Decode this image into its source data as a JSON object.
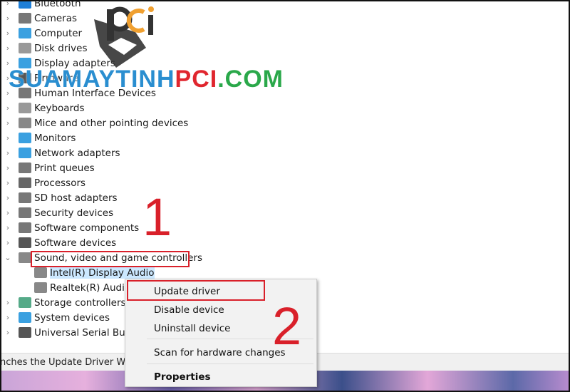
{
  "tree": {
    "items": [
      {
        "label": "Bluetooth",
        "icon": "bluetooth-icon",
        "color": "#1e7fd8"
      },
      {
        "label": "Cameras",
        "icon": "camera-icon",
        "color": "#777"
      },
      {
        "label": "Computer",
        "icon": "computer-icon",
        "color": "#3aa0e0"
      },
      {
        "label": "Disk drives",
        "icon": "disk-drive-icon",
        "color": "#999"
      },
      {
        "label": "Display adapters",
        "icon": "display-adapter-icon",
        "color": "#3aa0e0"
      },
      {
        "label": "Firmware",
        "icon": "firmware-icon",
        "color": "#555"
      },
      {
        "label": "Human Interface Devices",
        "icon": "hid-icon",
        "color": "#777"
      },
      {
        "label": "Keyboards",
        "icon": "keyboard-icon",
        "color": "#999"
      },
      {
        "label": "Mice and other pointing devices",
        "icon": "mouse-icon",
        "color": "#888"
      },
      {
        "label": "Monitors",
        "icon": "monitor-icon",
        "color": "#3aa0e0"
      },
      {
        "label": "Network adapters",
        "icon": "network-icon",
        "color": "#3aa0e0"
      },
      {
        "label": "Print queues",
        "icon": "printer-icon",
        "color": "#777"
      },
      {
        "label": "Processors",
        "icon": "processor-icon",
        "color": "#666"
      },
      {
        "label": "SD host adapters",
        "icon": "sd-card-icon",
        "color": "#777"
      },
      {
        "label": "Security devices",
        "icon": "security-icon",
        "color": "#777"
      },
      {
        "label": "Software components",
        "icon": "software-component-icon",
        "color": "#777"
      },
      {
        "label": "Software devices",
        "icon": "software-device-icon",
        "color": "#555"
      },
      {
        "label": "Sound, video and game controllers",
        "icon": "speaker-icon",
        "color": "#888",
        "expanded": true
      },
      {
        "label": "Intel(R) Display Audio",
        "icon": "speaker-icon",
        "color": "#888",
        "child": true,
        "selected": true
      },
      {
        "label": "Realtek(R) Audio",
        "icon": "speaker-icon",
        "color": "#888",
        "child": true
      },
      {
        "label": "Storage controllers",
        "icon": "storage-icon",
        "color": "#5a8"
      },
      {
        "label": "System devices",
        "icon": "system-icon",
        "color": "#3aa0e0"
      },
      {
        "label": "Universal Serial Bus c",
        "icon": "usb-icon",
        "color": "#555"
      }
    ]
  },
  "context_menu": {
    "items": [
      "Update driver",
      "Disable device",
      "Uninstall device",
      "Scan for hardware changes",
      "Properties"
    ]
  },
  "status_bar": "nches the Update Driver Wiza",
  "annotations": {
    "step1": "1",
    "step2": "2",
    "color": "#d9202a"
  },
  "watermark": {
    "part1": "SUAMAYTINH",
    "part2": "PCI",
    "part3": ".COM",
    "logo": "pci"
  }
}
